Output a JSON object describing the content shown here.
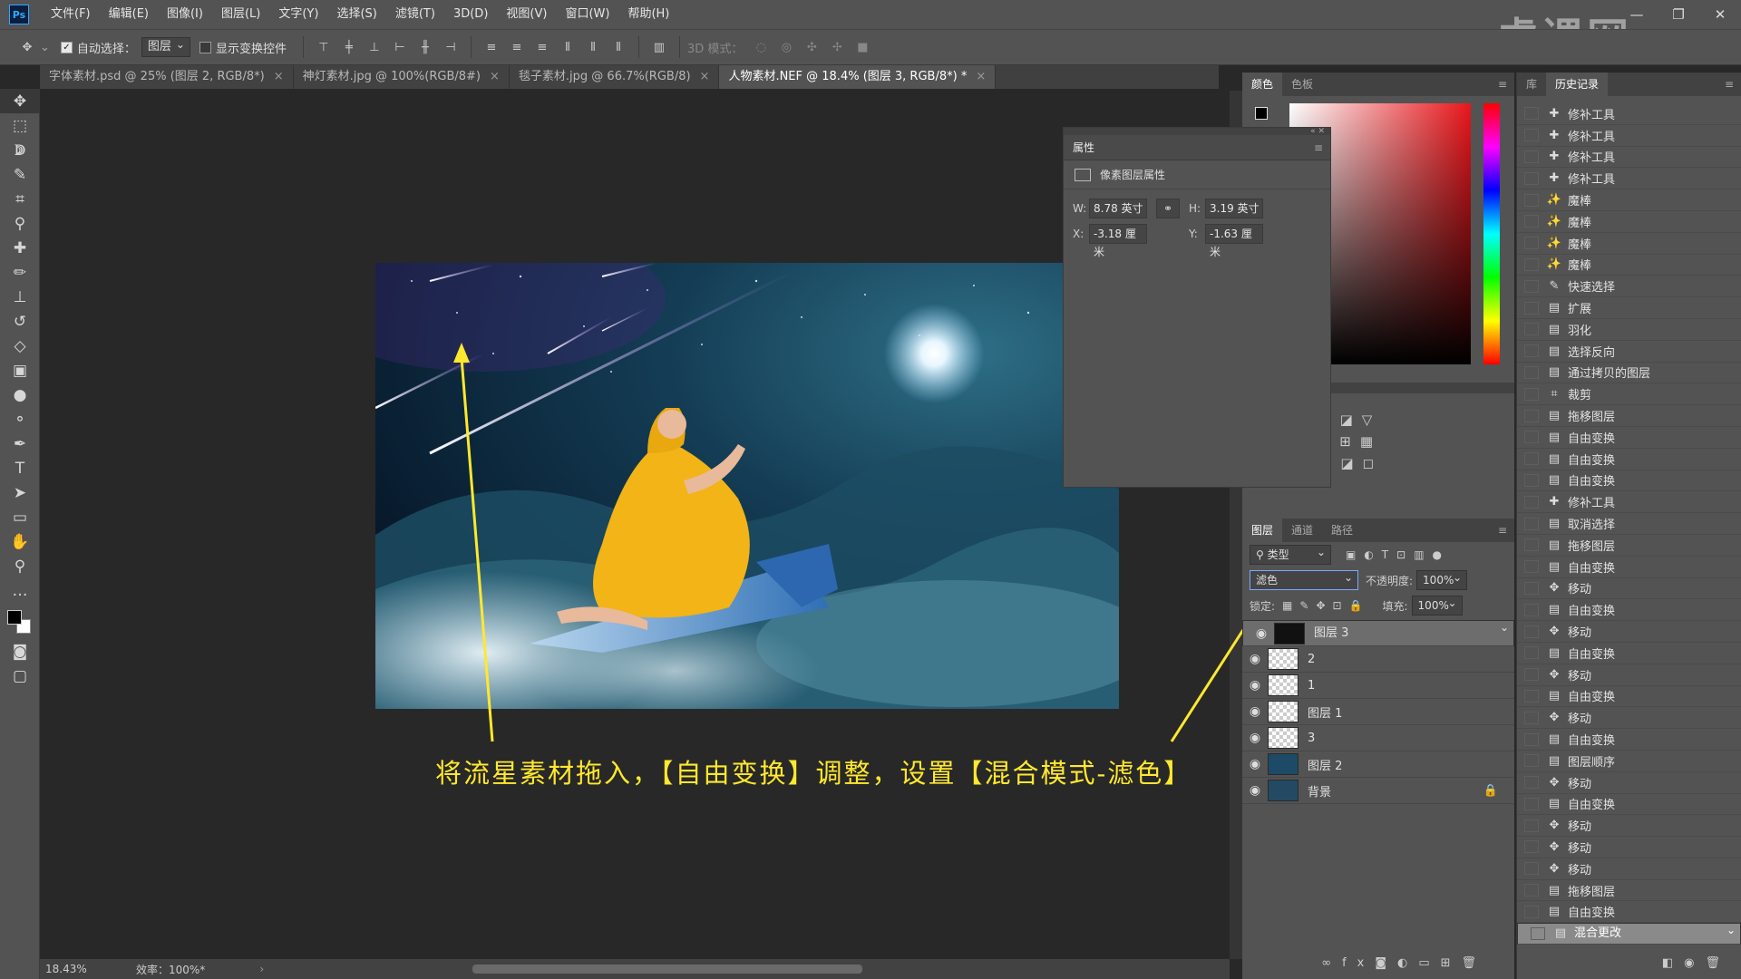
{
  "app": {
    "logo": "Ps"
  },
  "menubar": {
    "items": [
      "文件(F)",
      "编辑(E)",
      "图像(I)",
      "图层(L)",
      "文字(Y)",
      "选择(S)",
      "滤镜(T)",
      "3D(D)",
      "视图(V)",
      "窗口(W)",
      "帮助(H)"
    ]
  },
  "watermark": {
    "text": "虎课网"
  },
  "options_bar": {
    "auto_select_label": "自动选择：",
    "auto_select_value": "图层",
    "show_transform_label": "显示变换控件",
    "mode_3d_label": "3D 模式："
  },
  "tabs": [
    {
      "label": "字体素材.psd @ 25% (图层 2, RGB/8*)"
    },
    {
      "label": "神灯素材.jpg @ 100%(RGB/8#)"
    },
    {
      "label": "毯子素材.jpg @ 66.7%(RGB/8)"
    },
    {
      "label": "人物素材.NEF @ 18.4% (图层 3, RGB/8*) *"
    }
  ],
  "properties": {
    "title": "属性",
    "subtitle": "像素图层属性",
    "w_label": "W:",
    "w_value": "8.78 英寸",
    "h_label": "H:",
    "h_value": "3.19 英寸",
    "x_label": "X:",
    "x_value": "-3.18 厘米",
    "y_label": "Y:",
    "y_value": "-1.63 厘米"
  },
  "color_panel": {
    "tabs": [
      "颜色",
      "色板"
    ],
    "accent": "#e8161b"
  },
  "layers_panel": {
    "tabs": [
      "图层",
      "通道",
      "路径"
    ],
    "filter_label": "类型",
    "blend_mode": "滤色",
    "opacity_label": "不透明度:",
    "opacity_value": "100%",
    "lock_label": "锁定:",
    "fill_label": "填充:",
    "fill_value": "100%",
    "layers": [
      {
        "name": "图层 3"
      },
      {
        "name": "2"
      },
      {
        "name": "1"
      },
      {
        "name": "图层 1"
      },
      {
        "name": "3"
      },
      {
        "name": "图层 2"
      },
      {
        "name": "背景"
      }
    ]
  },
  "history_panel": {
    "tabs": [
      "库",
      "历史记录"
    ],
    "items": [
      "修补工具",
      "修补工具",
      "修补工具",
      "修补工具",
      "魔棒",
      "魔棒",
      "魔棒",
      "魔棒",
      "快速选择",
      "扩展",
      "羽化",
      "选择反向",
      "通过拷贝的图层",
      "裁剪",
      "拖移图层",
      "自由变换",
      "自由变换",
      "自由变换",
      "修补工具",
      "取消选择",
      "拖移图层",
      "自由变换",
      "移动",
      "自由变换",
      "移动",
      "自由变换",
      "移动",
      "自由变换",
      "移动",
      "自由变换",
      "图层顺序",
      "移动",
      "自由变换",
      "移动",
      "移动",
      "移动",
      "拖移图层",
      "自由变换",
      "混合更改"
    ]
  },
  "status": {
    "zoom": "18.43%",
    "efficiency": "效率：100%*"
  },
  "annotation": {
    "caption": "将流星素材拖入，【自由变换】调整，设置【混合模式-滤色】",
    "color": "#ffe82e"
  }
}
